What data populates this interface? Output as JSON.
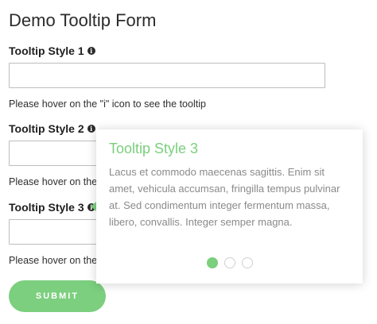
{
  "form": {
    "title": "Demo Tooltip Form",
    "info_icon_glyph": "i",
    "fields": [
      {
        "label": "Tooltip Style 1",
        "hint": "Please hover on the \"i\" icon to see the tooltip",
        "value": ""
      },
      {
        "label": "Tooltip Style 2",
        "hint": "Please hover on the",
        "value": ""
      },
      {
        "label": "Tooltip Style 3",
        "hint": "Please hover on the",
        "value": ""
      }
    ],
    "submit_label": "SUBMIT"
  },
  "tooltip": {
    "title": "Tooltip Style 3",
    "body": "Lacus et commodo maecenas sagittis. Enim sit amet, vehicula accumsan, fringilla tempus pulvinar at. Sed condimentum integer fermentum massa, libero, convallis. Integer semper magna.",
    "pagination": {
      "active_index": 0,
      "total": 3
    }
  },
  "colors": {
    "accent": "#7bcf7e",
    "tooltip_text": "#8a8a8a"
  },
  "icons": [
    "info-icon"
  ]
}
